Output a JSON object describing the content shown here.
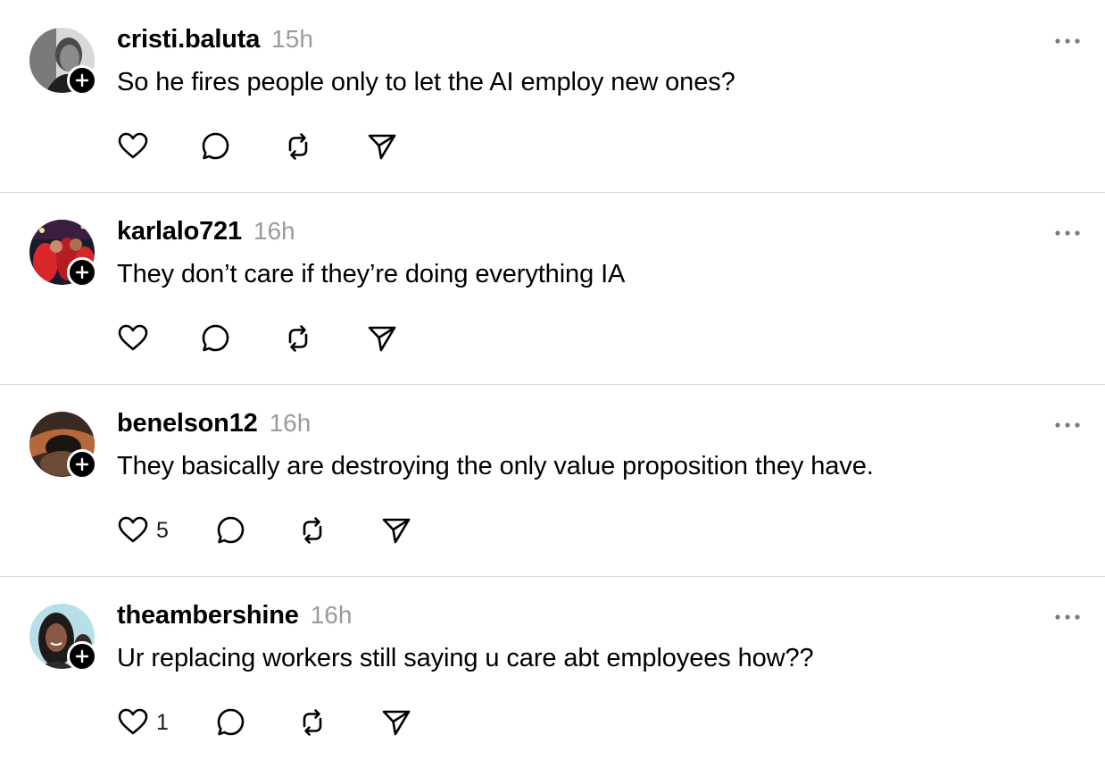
{
  "posts": [
    {
      "username": "cristi.baluta",
      "time": "15h",
      "text": "So he fires people only to let the AI employ new ones?",
      "likes": "",
      "avatar_palette": [
        "#4a4a4a",
        "#d8d8d8",
        "#1f1f1f"
      ]
    },
    {
      "username": "karlalo721",
      "time": "16h",
      "text": "They don’t care if they’re doing everything IA",
      "likes": "",
      "avatar_palette": [
        "#3a1d3f",
        "#d9262b",
        "#1a1a2e"
      ]
    },
    {
      "username": "benelson12",
      "time": "16h",
      "text": "They basically are destroying the only value proposition they have.",
      "likes": "5",
      "avatar_palette": [
        "#3b2a22",
        "#b5683c",
        "#1c1410"
      ]
    },
    {
      "username": "theambershine",
      "time": "16h",
      "text": "Ur replacing workers still saying u care abt employees how??",
      "likes": "1",
      "avatar_palette": [
        "#b8dfe8",
        "#8a5a44",
        "#1e1a1a"
      ]
    }
  ],
  "icons": {
    "like": "heart-icon",
    "reply": "comment-icon",
    "repost": "repost-icon",
    "share": "send-icon",
    "more": "more-icon",
    "follow": "plus-icon"
  }
}
